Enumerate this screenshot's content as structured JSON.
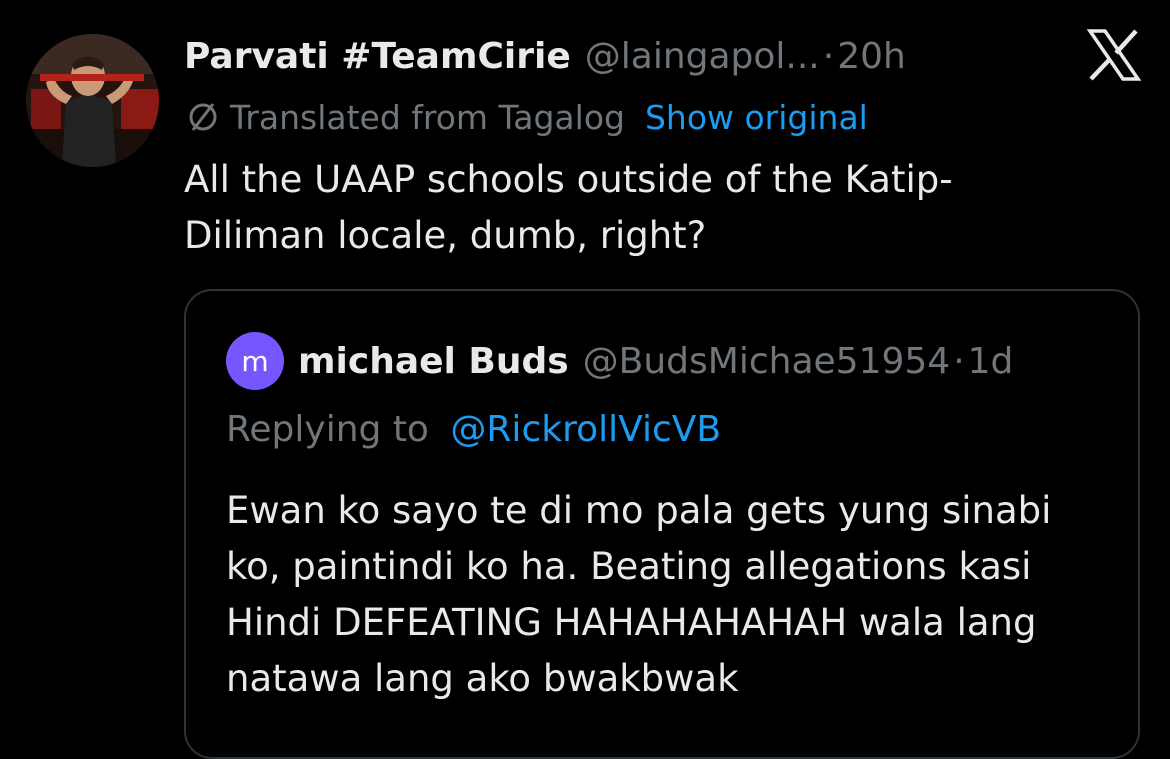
{
  "tweet": {
    "author_name": "Parvati #TeamCirie",
    "author_handle": "@laingapol...",
    "separator": "·",
    "time": "20h",
    "translated_label": "Translated from Tagalog",
    "show_original_label": "Show original",
    "text": "All the UAAP schools outside of the Katip-Diliman locale, dumb, right?",
    "icons": {
      "avatar": "profile-photo",
      "platform_logo": "x-logo-icon",
      "translate": "translate-icon"
    }
  },
  "quote": {
    "avatar_initial": "m",
    "author_name": "michael Buds",
    "author_handle": "@BudsMichae51954",
    "separator": "·",
    "time": "1d",
    "reply_label": "Replying to",
    "reply_handle": "@RickrollVicVB",
    "text": "Ewan ko sayo te di mo pala gets yung sinabi ko, paintindi ko ha. Beating allegations kasi Hindi DEFEATING HAHAHAHAHAH wala lang natawa lang ako bwakbwak"
  },
  "colors": {
    "background": "#000000",
    "primary_text": "#e7e9ea",
    "secondary_text": "#71767b",
    "link": "#1d9bf0",
    "border": "#2f3336",
    "quote_avatar": "#7856ff"
  }
}
